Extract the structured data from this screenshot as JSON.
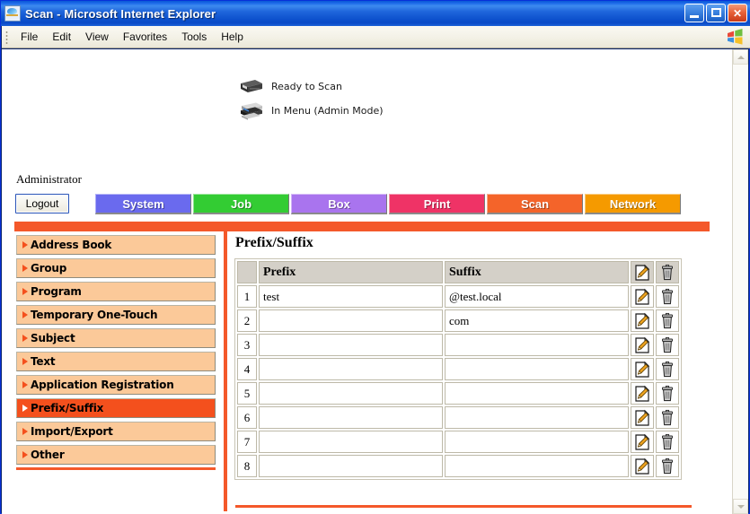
{
  "window": {
    "title": "Scan - Microsoft Internet Explorer",
    "icon": "ie-document-icon",
    "minimize_label": "Minimize",
    "maximize_label": "Maximize",
    "close_label": "Close"
  },
  "menubar": {
    "items": [
      {
        "label": "File"
      },
      {
        "label": "Edit"
      },
      {
        "label": "View"
      },
      {
        "label": "Favorites"
      },
      {
        "label": "Tools"
      },
      {
        "label": "Help"
      }
    ],
    "logo": "windows-flag-logo"
  },
  "status": {
    "rows": [
      {
        "icon": "scanner-icon",
        "label": "Ready to Scan"
      },
      {
        "icon": "printer-icon",
        "label": "In Menu (Admin Mode)"
      }
    ]
  },
  "account": {
    "user_label": "Administrator",
    "logout_label": "Logout"
  },
  "tabs": [
    {
      "label": "System",
      "color": "#6a6aee"
    },
    {
      "label": "Job",
      "color": "#33cc33"
    },
    {
      "label": "Box",
      "color": "#a974ee"
    },
    {
      "label": "Print",
      "color": "#ef3366"
    },
    {
      "label": "Scan",
      "color": "#f4642a"
    },
    {
      "label": "Network",
      "color": "#f59a00"
    }
  ],
  "sidebar": {
    "items": [
      {
        "label": "Address Book",
        "active": false
      },
      {
        "label": "Group",
        "active": false
      },
      {
        "label": "Program",
        "active": false
      },
      {
        "label": "Temporary One-Touch",
        "active": false
      },
      {
        "label": "Subject",
        "active": false
      },
      {
        "label": "Text",
        "active": false
      },
      {
        "label": "Application Registration",
        "active": false
      },
      {
        "label": "Prefix/Suffix",
        "active": true
      },
      {
        "label": "Import/Export",
        "active": false
      },
      {
        "label": "Other",
        "active": false
      }
    ]
  },
  "content": {
    "title": "Prefix/Suffix",
    "table": {
      "headers": [
        "",
        "Prefix",
        "Suffix",
        "edit-icon",
        "delete-icon"
      ],
      "header_prefix": "Prefix",
      "header_suffix": "Suffix",
      "rows": [
        {
          "no": "1",
          "prefix": "test",
          "suffix": "@test.local"
        },
        {
          "no": "2",
          "prefix": "",
          "suffix": "com"
        },
        {
          "no": "3",
          "prefix": "",
          "suffix": ""
        },
        {
          "no": "4",
          "prefix": "",
          "suffix": ""
        },
        {
          "no": "5",
          "prefix": "",
          "suffix": ""
        },
        {
          "no": "6",
          "prefix": "",
          "suffix": ""
        },
        {
          "no": "7",
          "prefix": "",
          "suffix": ""
        },
        {
          "no": "8",
          "prefix": "",
          "suffix": ""
        }
      ]
    }
  },
  "theme": {
    "accent_orange": "#f4582a",
    "sidebar_item_bg": "#fbc999",
    "sidebar_active_bg": "#f4501d",
    "header_cell_bg": "#d4d0c8"
  },
  "scrollbar": {
    "up_label": "Scroll up",
    "down_label": "Scroll down"
  }
}
